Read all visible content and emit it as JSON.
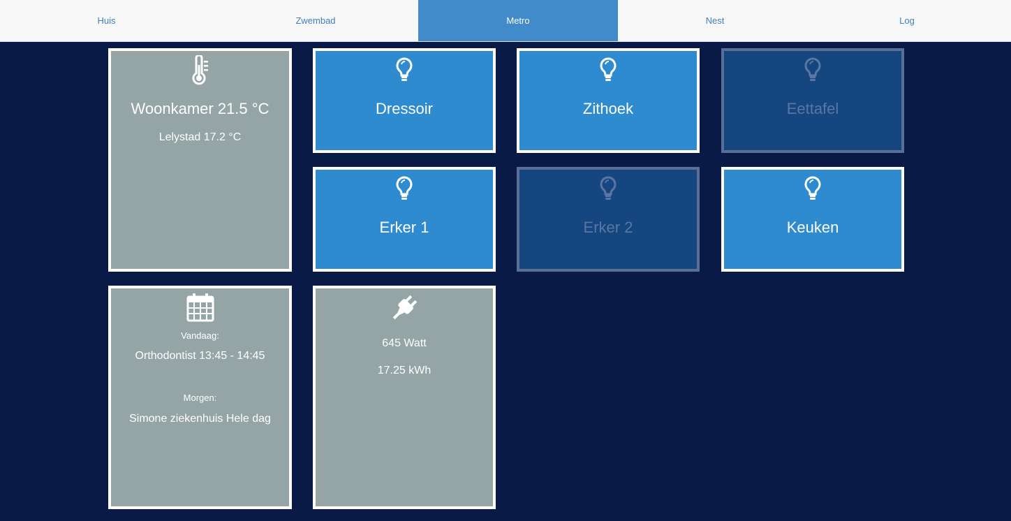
{
  "nav": {
    "tabs": [
      {
        "label": "Huis"
      },
      {
        "label": "Zwembad"
      },
      {
        "label": "Metro"
      },
      {
        "label": "Nest"
      },
      {
        "label": "Log"
      }
    ],
    "active_index": 2
  },
  "temperature": {
    "icon": "thermometer-icon",
    "indoor": "Woonkamer 21.5 °C",
    "outdoor": "Lelystad 17.2 °C"
  },
  "lights": [
    {
      "label": "Dressoir",
      "state": "on",
      "icon": "lightbulb-icon"
    },
    {
      "label": "Zithoek",
      "state": "on",
      "icon": "lightbulb-icon"
    },
    {
      "label": "Eettafel",
      "state": "off",
      "icon": "lightbulb-icon"
    },
    {
      "label": "Erker 1",
      "state": "on",
      "icon": "lightbulb-icon"
    },
    {
      "label": "Erker 2",
      "state": "off",
      "icon": "lightbulb-icon"
    },
    {
      "label": "Keuken",
      "state": "on",
      "icon": "lightbulb-icon"
    }
  ],
  "calendar": {
    "icon": "calendar-icon",
    "today_label": "Vandaag:",
    "today_event_title": "Orthodontist",
    "today_event_time": "13:45 - 14:45",
    "tomorrow_label": "Morgen:",
    "tomorrow_event_title": "Simone ziekenhuis",
    "tomorrow_event_time": "Hele dag"
  },
  "power": {
    "icon": "plug-icon",
    "current": "645 Watt",
    "total": "17.25 kWh"
  },
  "colors": {
    "background": "#0a1a47",
    "navbar": "#f8f8f8",
    "nav_active": "#428bca",
    "tile_on": "#2e8bcf",
    "tile_off": "#15467f",
    "tile_grey": "#95a5a6"
  }
}
